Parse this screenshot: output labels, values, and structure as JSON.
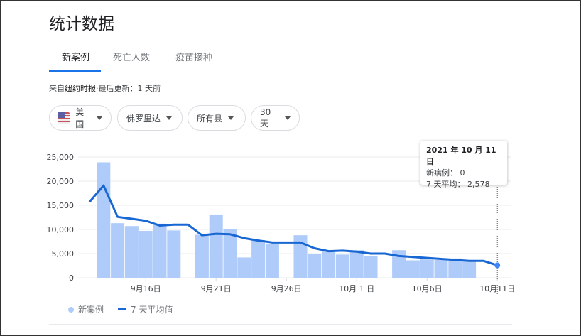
{
  "title": "统计数据",
  "tabs": [
    {
      "label": "新案例"
    },
    {
      "label": "死亡人数"
    },
    {
      "label": "疫苗接种"
    }
  ],
  "source": {
    "prefix": "来自",
    "link": "纽约时报",
    "suffix": "·最后更新：1 天前"
  },
  "filters": [
    {
      "label": "美国",
      "icon": "us-flag-icon"
    },
    {
      "label": "佛罗里达"
    },
    {
      "label": "所有县"
    },
    {
      "label": "30天"
    }
  ],
  "tooltip": {
    "date": "2021 年 10 月 11 日",
    "cases_label": "新病例：",
    "cases_value": "0",
    "avg_label": "7 天平均：",
    "avg_value": "2,578"
  },
  "legend": {
    "bars": "新案例",
    "line": "7 天平均值"
  },
  "colors": {
    "bar": "#aecbfa",
    "line": "#1967d2",
    "accent": "#1a73e8"
  },
  "chart_data": {
    "type": "bar",
    "x": [
      "9/12",
      "9/13",
      "9/14",
      "9/15",
      "9/16",
      "9/17",
      "9/18",
      "9/19",
      "9/20",
      "9/21",
      "9/22",
      "9/23",
      "9/24",
      "9/25",
      "9/26",
      "9/27",
      "9/28",
      "9/29",
      "9/30",
      "10/1",
      "10/2",
      "10/3",
      "10/4",
      "10/5",
      "10/6",
      "10/7",
      "10/8",
      "10/9",
      "10/10",
      "10/11"
    ],
    "series": [
      {
        "name": "新案例",
        "type": "bar",
        "values": [
          0,
          23900,
          11300,
          10700,
          9700,
          11200,
          9800,
          0,
          8900,
          13100,
          10000,
          4200,
          7800,
          7000,
          0,
          8800,
          5000,
          5600,
          4800,
          5700,
          4500,
          0,
          5700,
          3600,
          3800,
          3700,
          4000,
          3400,
          0,
          0
        ]
      },
      {
        "name": "7 天平均值",
        "type": "line",
        "values": [
          15700,
          19100,
          12600,
          12200,
          11800,
          10800,
          11000,
          11000,
          8800,
          9100,
          9000,
          8200,
          7700,
          7300,
          7300,
          7300,
          6100,
          5500,
          5600,
          5400,
          5000,
          5000,
          4500,
          4300,
          4100,
          3900,
          3700,
          3500,
          3500,
          2578
        ]
      }
    ],
    "yticks": [
      "0",
      "5,000",
      "10,000",
      "15,000",
      "20,000",
      "25,000"
    ],
    "ytick_values": [
      0,
      5000,
      10000,
      15000,
      20000,
      25000
    ],
    "xticks": [
      {
        "label": "9月16日",
        "index": 4
      },
      {
        "label": "9月21日",
        "index": 9
      },
      {
        "label": "9月26日",
        "index": 14
      },
      {
        "label": "10月 1 日",
        "index": 19
      },
      {
        "label": "10月6日",
        "index": 24
      },
      {
        "label": "10月11日",
        "index": 29
      }
    ],
    "ylim": [
      0,
      25000
    ],
    "grid": true
  }
}
